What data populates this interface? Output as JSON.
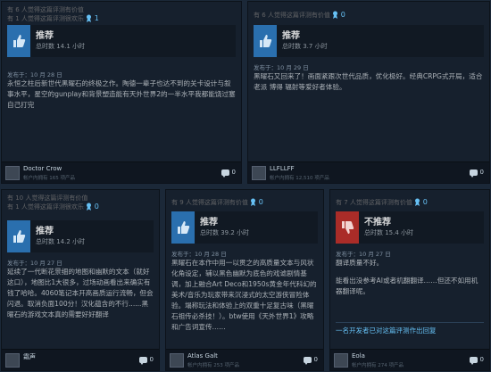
{
  "reviews": [
    {
      "helpful_1": "有 6 人觉得这篇评测有价值",
      "helpful_2": "有 1 人觉得这篇评测很欢乐",
      "award_count": "1",
      "verdict": "推荐",
      "hours": "总时数 14.1 小时",
      "posted": "发布于：10 月 28 日",
      "text": "永恒之柱后新世代黑曜石的终极之作。陶德一辈子也达不到的关卡设计与叙事水平，星空的gunplay和背景塑造能有天外世界2的一半水平我都能饶过塞自己打完",
      "author": "Doctor Crow",
      "owned": "帐户内拥有 165 项产品",
      "comments": "0"
    },
    {
      "helpful_1": "有 6 人觉得这篇评测有价值",
      "award_count": "0",
      "verdict": "推荐",
      "hours": "总时数 3.7 小时",
      "posted": "发布于：10 月 29 日",
      "text": "黑曜石又回来了！画面紧跟次世代品质，优化极好。经典CRPG式开局，适合老派 博得 辐射等爱好者体验。",
      "author": "LLFLLFF",
      "owned": "帐户内拥有 12,510 项产品",
      "comments": "0"
    },
    {
      "helpful_1": "有 10 人觉得这篇评测有价值",
      "helpful_2": "有 1 人觉得这篇评测很欢乐",
      "award_count": "0",
      "verdict": "推荐",
      "hours": "总时数 14.2 小时",
      "posted": "发布于：10 月 27 日",
      "text": "延续了一代断花景细的地图和幽默的文本（就好这口），地图比1大很多，过场动画看出来确实有钱了哈哈。4060笔记本开高画质运行流畅，但会闪退。取消负面100分！汉化蕴含的不行......黑曜石的游戏文本真的需要好好翻译",
      "author": "霜声",
      "owned": "",
      "comments": "0"
    },
    {
      "helpful_1": "有 9 人觉得这篇评测有价值",
      "award_count": "0",
      "verdict": "推荐",
      "hours": "总时数 39.2 小时",
      "posted": "发布于：10 月 28 日",
      "text": "黑曜石在本作中用一以贯之的高质量文本与风状化角设定，辅以黑色幽默为底色的戏谑剧情基调，加上融合Art Deco和1950s黄金年代科幻的美术/音乐为玩家带来沉浸式的太空游侠冒险体验。塌称玩法和体验上的双重十足复古味（黑曜石祖传必杀技！）。btw使用《天外世界1》攻略和广告词宣传……",
      "author": "Atlas Galt",
      "owned": "帐户内拥有 253 项产品",
      "comments": "0"
    },
    {
      "helpful_1": "有 7 人觉得这篇评测有价值",
      "award_count": "0",
      "verdict": "不推荐",
      "hours": "总时数 15.4 小时",
      "posted": "发布于：10 月 27 日",
      "text_1": "翻译质量不好。",
      "text_2": "能看出没参考AI或者机翻翻译……但还不如用机器翻译呢。",
      "dev_reply": "一名开发者已对这篇评测作出回复",
      "author": "Eola",
      "owned": "帐户内拥有 274 项产品",
      "comments": "0"
    }
  ]
}
